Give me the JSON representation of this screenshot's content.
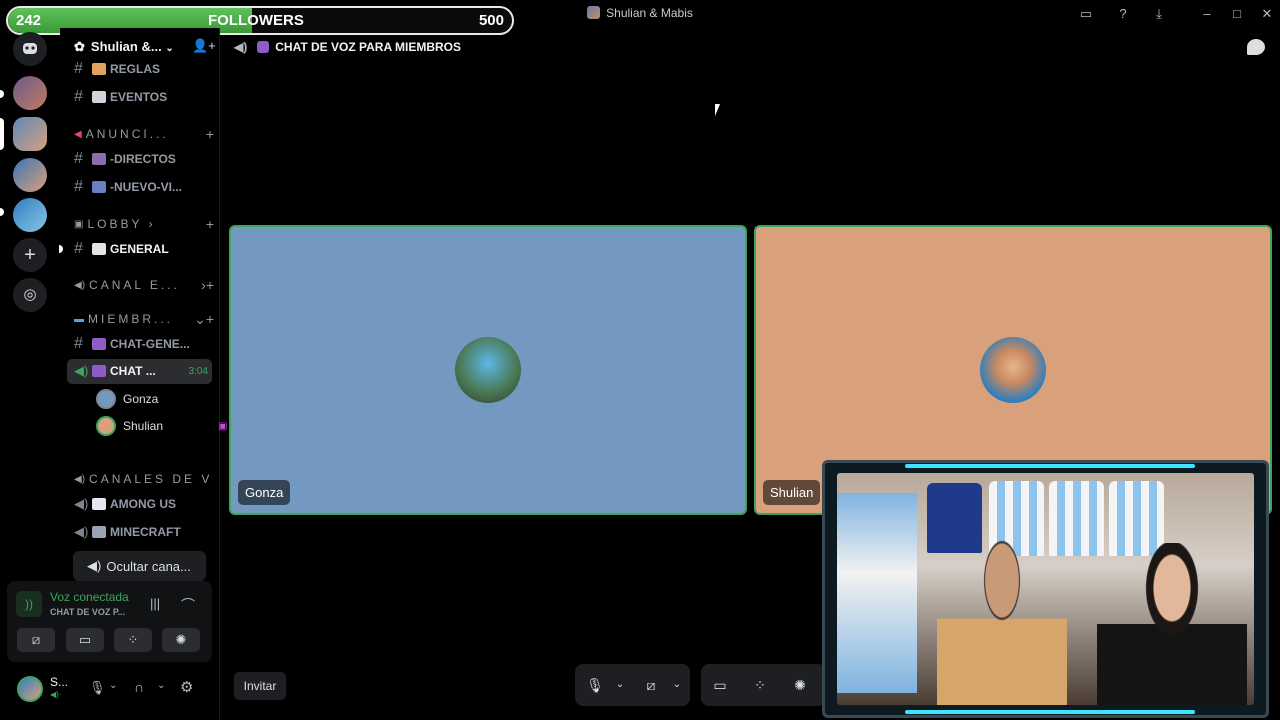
{
  "window": {
    "title": "Shulian & Mabis"
  },
  "followers": {
    "current": "242",
    "label": "FOLLOWERS",
    "goal": "500",
    "progress": 0.484
  },
  "server": {
    "name": "Shulian &..."
  },
  "channels": [
    {
      "label": "REGLAS"
    },
    {
      "label": "EVENTOS"
    },
    {
      "label": "-DIRECTOS"
    },
    {
      "label": "-NUEVO-VI..."
    },
    {
      "label": "GENERAL"
    },
    {
      "label": "CHAT-GENE..."
    },
    {
      "label": "AMONG US"
    },
    {
      "label": "MINECRAFT"
    }
  ],
  "categories": [
    {
      "label": "ANUNCI..."
    },
    {
      "label": "LOBBY ›"
    },
    {
      "label": "CANAL E..."
    },
    {
      "label": "MIEMBR..."
    },
    {
      "label": "CANALES DE V"
    }
  ],
  "active_voice": {
    "label": "CHAT ...",
    "time": "3:04"
  },
  "members": [
    {
      "name": "Gonza"
    },
    {
      "name": "Shulian"
    }
  ],
  "hide_button": "Ocultar cana...",
  "voice_panel": {
    "status": "Voz conectada",
    "channel": "CHAT DE VOZ P..."
  },
  "user": {
    "short_name": "S..."
  },
  "header": {
    "channel_name": "CHAT DE VOZ PARA MIEMBROS"
  },
  "tiles": [
    {
      "name": "Gonza",
      "color": "#7499c0"
    },
    {
      "name": "Shulian",
      "color": "#d9a07c"
    }
  ],
  "invite": "Invitar",
  "colors": {
    "accent_green": "#3ba55c",
    "webcam_frame": "#3ee4ff"
  }
}
